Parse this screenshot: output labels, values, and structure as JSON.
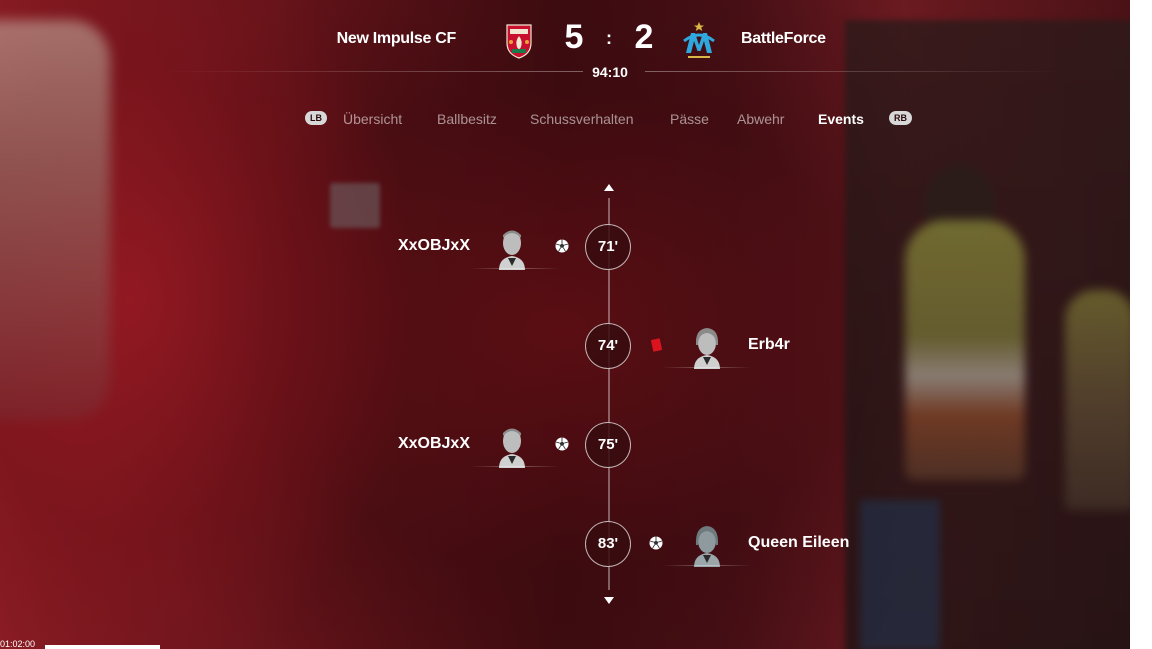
{
  "match": {
    "home_team": "New Impulse CF",
    "away_team": "BattleForce",
    "home_score": "5",
    "separator": ":",
    "away_score": "2",
    "clock": "94:10"
  },
  "tabs": {
    "left_button": "LB",
    "right_button": "RB",
    "items": [
      "Übersicht",
      "Ballbesitz",
      "Schussverhalten",
      "Pässe",
      "Abwehr",
      "Events"
    ],
    "active": "Events"
  },
  "events": [
    {
      "minute": "71'",
      "side": "home",
      "player": "XxOBJxX",
      "type": "goal",
      "icon": "soccer-ball-icon"
    },
    {
      "minute": "74'",
      "side": "away",
      "player": "Erb4r",
      "type": "red-card",
      "icon": "red-card-icon"
    },
    {
      "minute": "75'",
      "side": "home",
      "player": "XxOBJxX",
      "type": "goal",
      "icon": "soccer-ball-icon"
    },
    {
      "minute": "83'",
      "side": "away",
      "player": "Queen Eileen",
      "type": "goal",
      "icon": "soccer-ball-icon"
    }
  ],
  "overlay": {
    "timecode": "01:02:00"
  },
  "colors": {
    "background": "#2a0a0c",
    "red_card": "#d9141e",
    "home_crest": "#c8102e",
    "away_crest": "#2fa8e0"
  }
}
